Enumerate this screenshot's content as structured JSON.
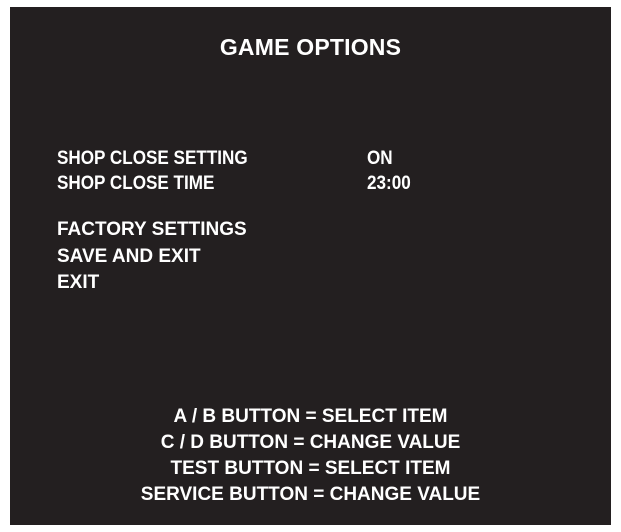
{
  "screen": {
    "title": "GAME OPTIONS",
    "settings": [
      {
        "label": "SHOP CLOSE SETTING",
        "value": "ON"
      },
      {
        "label": "SHOP CLOSE TIME",
        "value": "23:00"
      }
    ],
    "menu": [
      "FACTORY SETTINGS",
      "SAVE AND EXIT",
      "EXIT"
    ],
    "help": [
      "A / B BUTTON = SELECT ITEM",
      "C / D BUTTON = CHANGE  VALUE",
      "TEST BUTTON = SELECT ITEM",
      "SERVICE BUTTON = CHANGE  VALUE"
    ]
  },
  "colors": {
    "background": "#231f20",
    "text": "#ffffff"
  }
}
